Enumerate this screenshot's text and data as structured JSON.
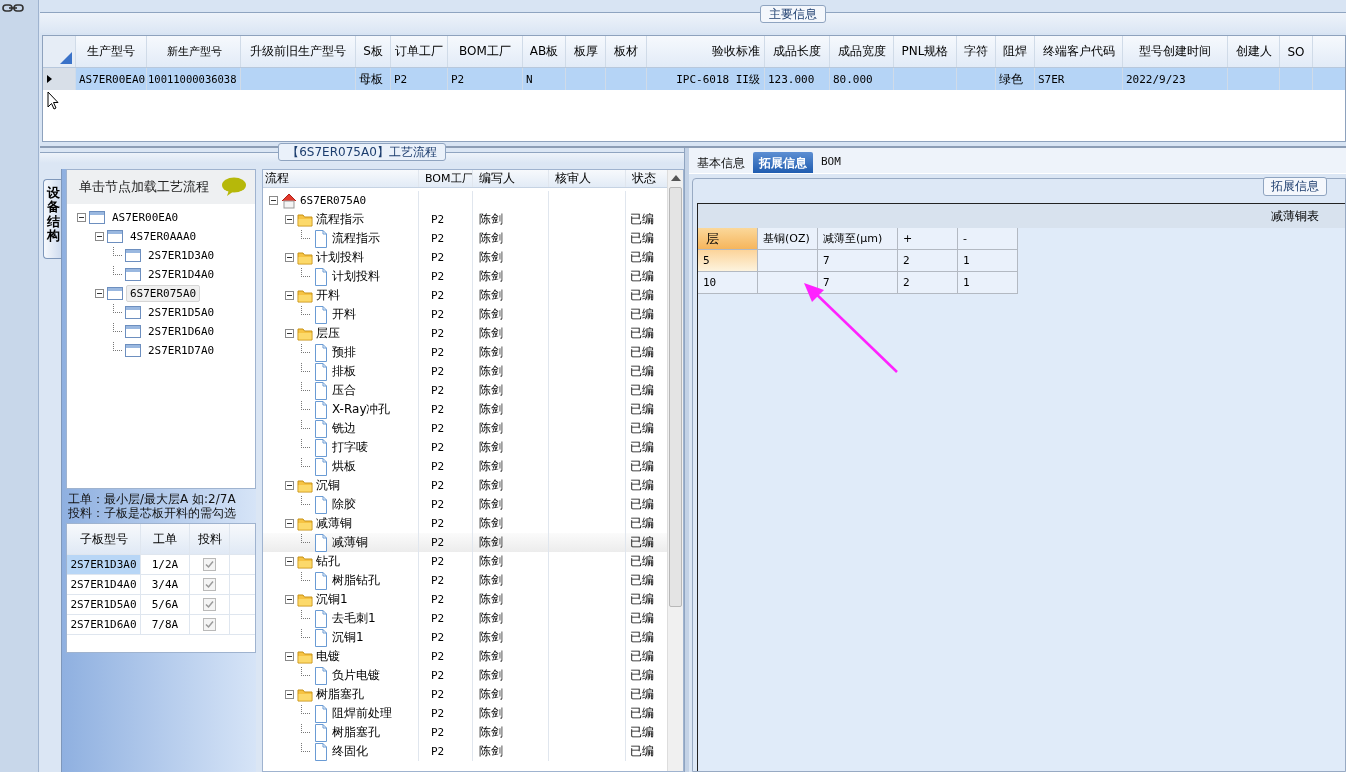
{
  "top": {
    "title": "主要信息",
    "columns": [
      "生产型号",
      "新生产型号",
      "升级前旧生产型号",
      "S板",
      "订单工厂",
      "BOM工厂",
      "AB板",
      "板厚",
      "板材",
      "验收标准",
      "成品长度",
      "成品宽度",
      "PNL规格",
      "字符",
      "阻焊",
      "终端客户代码",
      "型号创建时间",
      "创建人",
      "SO"
    ],
    "rows": [
      {
        "selected": true,
        "cells": [
          "AS7ER00EA0",
          "10011000036038",
          null,
          "母板",
          "P2",
          "P2",
          "N",
          null,
          null,
          "IPC-6018 II级",
          "123.000",
          "80.000",
          null,
          null,
          "绿色",
          "S7ER",
          "2022/9/23",
          null,
          null
        ]
      }
    ]
  },
  "flow": {
    "title": "【6S7ER075A0】工艺流程",
    "side_tab": "设备结构",
    "structure": {
      "hint": "单击节点加载工艺流程",
      "tree": [
        {
          "label": "AS7ER00EA0",
          "expanded": true,
          "selected": false,
          "children": [
            {
              "label": "4S7ER0AAA0",
              "expanded": true,
              "selected": false,
              "children": [
                {
                  "label": "2S7ER1D3A0",
                  "selected": false
                },
                {
                  "label": "2S7ER1D4A0",
                  "selected": false
                }
              ]
            },
            {
              "label": "6S7ER075A0",
              "expanded": true,
              "selected": true,
              "children": [
                {
                  "label": "2S7ER1D5A0",
                  "selected": false
                },
                {
                  "label": "2S7ER1D6A0",
                  "selected": false
                },
                {
                  "label": "2S7ER1D7A0",
                  "selected": false
                }
              ]
            }
          ]
        }
      ]
    },
    "notes": [
      "工单：最小层/最大层A 如:2/7A",
      "投料：子板是芯板开料的需勾选"
    ],
    "sub_boards": {
      "columns": [
        "子板型号",
        "工单",
        "投料"
      ],
      "rows": [
        {
          "cells": [
            "2S7ER1D3A0",
            "1/2A"
          ],
          "checked": true,
          "selected": true
        },
        {
          "cells": [
            "2S7ER1D4A0",
            "3/4A"
          ],
          "checked": true,
          "selected": false
        },
        {
          "cells": [
            "2S7ER1D5A0",
            "5/6A"
          ],
          "checked": true,
          "selected": false
        },
        {
          "cells": [
            "2S7ER1D6A0",
            "7/8A"
          ],
          "checked": true,
          "selected": false
        }
      ]
    },
    "process": {
      "columns": [
        "流程",
        "BOM工厂",
        "编写人",
        "核审人",
        "状态"
      ],
      "tree": [
        {
          "kind": "root",
          "label": "6S7ER075A0",
          "expanded": true,
          "selected": false,
          "children": [
            {
              "kind": "folder",
              "label": "流程指示",
              "factory": "P2",
              "author": "陈剑",
              "status": "已编",
              "expanded": true,
              "selected": false,
              "children": [
                {
                  "kind": "step",
                  "label": "流程指示",
                  "factory": "P2",
                  "author": "陈剑",
                  "status": "已编",
                  "selected": false
                }
              ]
            },
            {
              "kind": "folder",
              "label": "计划投料",
              "factory": "P2",
              "author": "陈剑",
              "status": "已编",
              "expanded": true,
              "selected": false,
              "children": [
                {
                  "kind": "step",
                  "label": "计划投料",
                  "factory": "P2",
                  "author": "陈剑",
                  "status": "已编",
                  "selected": false
                }
              ]
            },
            {
              "kind": "folder",
              "label": "开料",
              "factory": "P2",
              "author": "陈剑",
              "status": "已编",
              "expanded": true,
              "selected": false,
              "children": [
                {
                  "kind": "step",
                  "label": "开料",
                  "factory": "P2",
                  "author": "陈剑",
                  "status": "已编",
                  "selected": false
                }
              ]
            },
            {
              "kind": "folder",
              "label": "层压",
              "factory": "P2",
              "author": "陈剑",
              "status": "已编",
              "expanded": true,
              "selected": false,
              "children": [
                {
                  "kind": "step",
                  "label": "预排",
                  "factory": "P2",
                  "author": "陈剑",
                  "status": "已编",
                  "selected": false
                },
                {
                  "kind": "step",
                  "label": "排板",
                  "factory": "P2",
                  "author": "陈剑",
                  "status": "已编",
                  "selected": false
                },
                {
                  "kind": "step",
                  "label": "压合",
                  "factory": "P2",
                  "author": "陈剑",
                  "status": "已编",
                  "selected": false
                },
                {
                  "kind": "step",
                  "label": "X-Ray冲孔",
                  "factory": "P2",
                  "author": "陈剑",
                  "status": "已编",
                  "selected": false
                },
                {
                  "kind": "step",
                  "label": "铣边",
                  "factory": "P2",
                  "author": "陈剑",
                  "status": "已编",
                  "selected": false
                },
                {
                  "kind": "step",
                  "label": "打字唛",
                  "factory": "P2",
                  "author": "陈剑",
                  "status": "已编",
                  "selected": false
                },
                {
                  "kind": "step",
                  "label": "烘板",
                  "factory": "P2",
                  "author": "陈剑",
                  "status": "已编",
                  "selected": false
                }
              ]
            },
            {
              "kind": "folder",
              "label": "沉铜",
              "factory": "P2",
              "author": "陈剑",
              "status": "已编",
              "expanded": true,
              "selected": false,
              "children": [
                {
                  "kind": "step",
                  "label": "除胶",
                  "factory": "P2",
                  "author": "陈剑",
                  "status": "已编",
                  "selected": false
                }
              ]
            },
            {
              "kind": "folder",
              "label": "减薄铜",
              "factory": "P2",
              "author": "陈剑",
              "status": "已编",
              "expanded": true,
              "selected": false,
              "children": [
                {
                  "kind": "step",
                  "label": "减薄铜",
                  "factory": "P2",
                  "author": "陈剑",
                  "status": "已编",
                  "selected": true
                }
              ]
            },
            {
              "kind": "folder",
              "label": "钻孔",
              "factory": "P2",
              "author": "陈剑",
              "status": "已编",
              "expanded": true,
              "selected": false,
              "children": [
                {
                  "kind": "step",
                  "label": "树脂钻孔",
                  "factory": "P2",
                  "author": "陈剑",
                  "status": "已编",
                  "selected": false
                }
              ]
            },
            {
              "kind": "folder",
              "label": "沉铜1",
              "factory": "P2",
              "author": "陈剑",
              "status": "已编",
              "expanded": true,
              "selected": false,
              "children": [
                {
                  "kind": "step",
                  "label": "去毛刺1",
                  "factory": "P2",
                  "author": "陈剑",
                  "status": "已编",
                  "selected": false
                },
                {
                  "kind": "step",
                  "label": "沉铜1",
                  "factory": "P2",
                  "author": "陈剑",
                  "status": "已编",
                  "selected": false
                }
              ]
            },
            {
              "kind": "folder",
              "label": "电镀",
              "factory": "P2",
              "author": "陈剑",
              "status": "已编",
              "expanded": true,
              "selected": false,
              "children": [
                {
                  "kind": "step",
                  "label": "负片电镀",
                  "factory": "P2",
                  "author": "陈剑",
                  "status": "已编",
                  "selected": false
                }
              ]
            },
            {
              "kind": "folder",
              "label": "树脂塞孔",
              "factory": "P2",
              "author": "陈剑",
              "status": "已编",
              "expanded": true,
              "selected": false,
              "children": [
                {
                  "kind": "step",
                  "label": "阻焊前处理",
                  "factory": "P2",
                  "author": "陈剑",
                  "status": "已编",
                  "selected": false
                },
                {
                  "kind": "step",
                  "label": "树脂塞孔",
                  "factory": "P2",
                  "author": "陈剑",
                  "status": "已编",
                  "selected": false
                },
                {
                  "kind": "step",
                  "label": "终固化",
                  "factory": "P2",
                  "author": "陈剑",
                  "status": "已编",
                  "selected": false
                }
              ]
            }
          ]
        }
      ]
    }
  },
  "detail": {
    "tabs": [
      {
        "label": "基本信息",
        "selected": false
      },
      {
        "label": "拓展信息",
        "selected": true
      },
      {
        "label": "BOM",
        "selected": false
      }
    ],
    "panel_title": "拓展信息",
    "table_title": "减薄铜表",
    "columns": [
      "层",
      "基铜(OZ)",
      "减薄至(μm)",
      "+",
      "-"
    ],
    "rows": [
      {
        "selected": true,
        "cells": [
          "5",
          null,
          "7",
          "2",
          "1"
        ]
      },
      {
        "selected": false,
        "cells": [
          "10",
          null,
          "7",
          "2",
          "1"
        ]
      }
    ]
  }
}
